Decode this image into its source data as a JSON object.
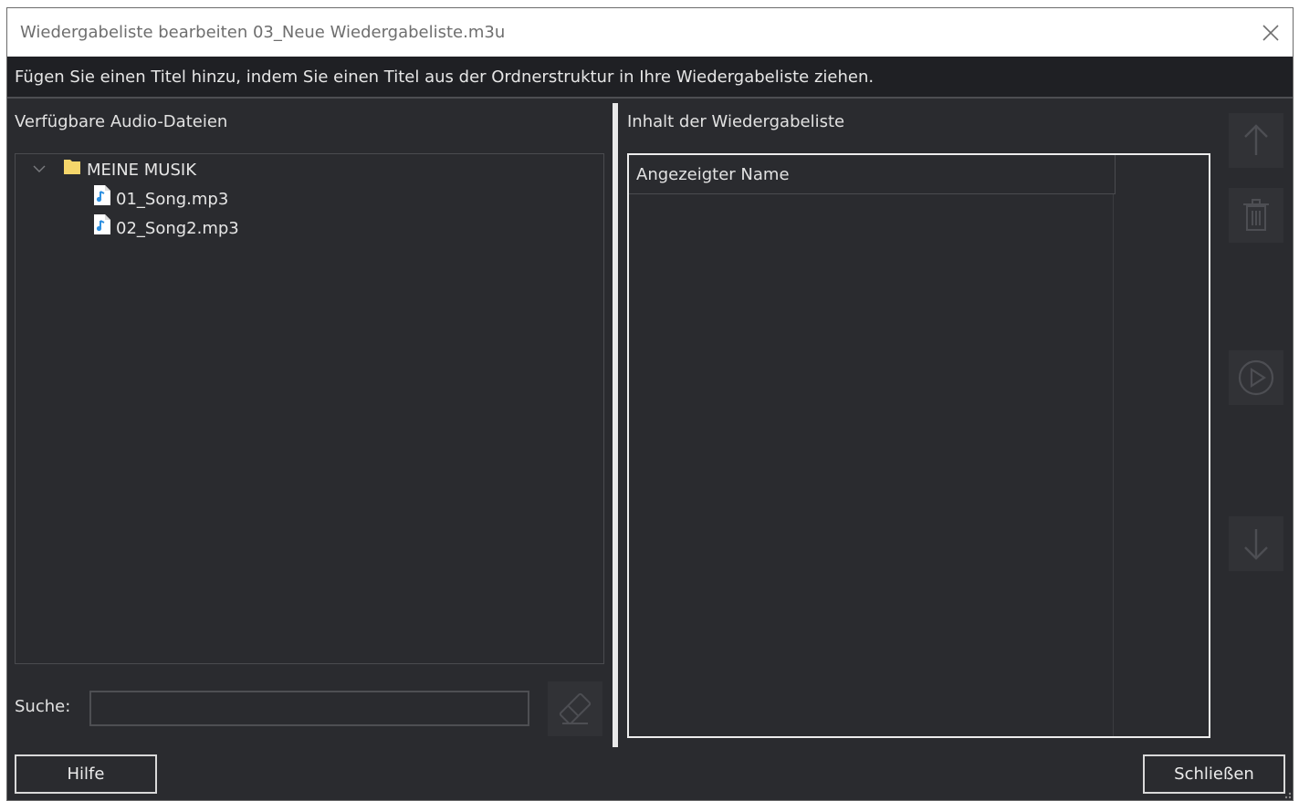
{
  "window": {
    "title": "Wiedergabeliste bearbeiten 03_Neue Wiedergabeliste.m3u",
    "close_icon": "close-icon"
  },
  "instruction": "Fügen Sie einen Titel hinzu, indem Sie einen Titel aus der Ordnerstruktur in Ihre Wiedergabeliste ziehen.",
  "left_panel": {
    "label": "Verfügbare Audio-Dateien",
    "tree": {
      "folder": {
        "label": "MEINE MUSIK",
        "expanded": true,
        "icon": "folder-icon"
      },
      "files": [
        {
          "label": "01_Song.mp3",
          "icon": "audio-file-icon"
        },
        {
          "label": "02_Song2.mp3",
          "icon": "audio-file-icon"
        }
      ]
    },
    "search": {
      "label": "Suche:",
      "value": "",
      "placeholder": ""
    },
    "clear_icon": "eraser-icon"
  },
  "right_panel": {
    "label": "Inhalt der Wiedergabeliste",
    "column_header": "Angezeigter Name",
    "rows": [],
    "buttons": [
      "move-up-icon",
      "delete-icon",
      "play-icon",
      "move-down-icon"
    ]
  },
  "footer": {
    "help_label": "Hilfe",
    "close_label": "Schließen"
  },
  "colors": {
    "background": "#2a2b2f",
    "instruction_bar": "#1f2024",
    "folder": "#f5d66b",
    "audio_file": "#2d8fe0"
  }
}
